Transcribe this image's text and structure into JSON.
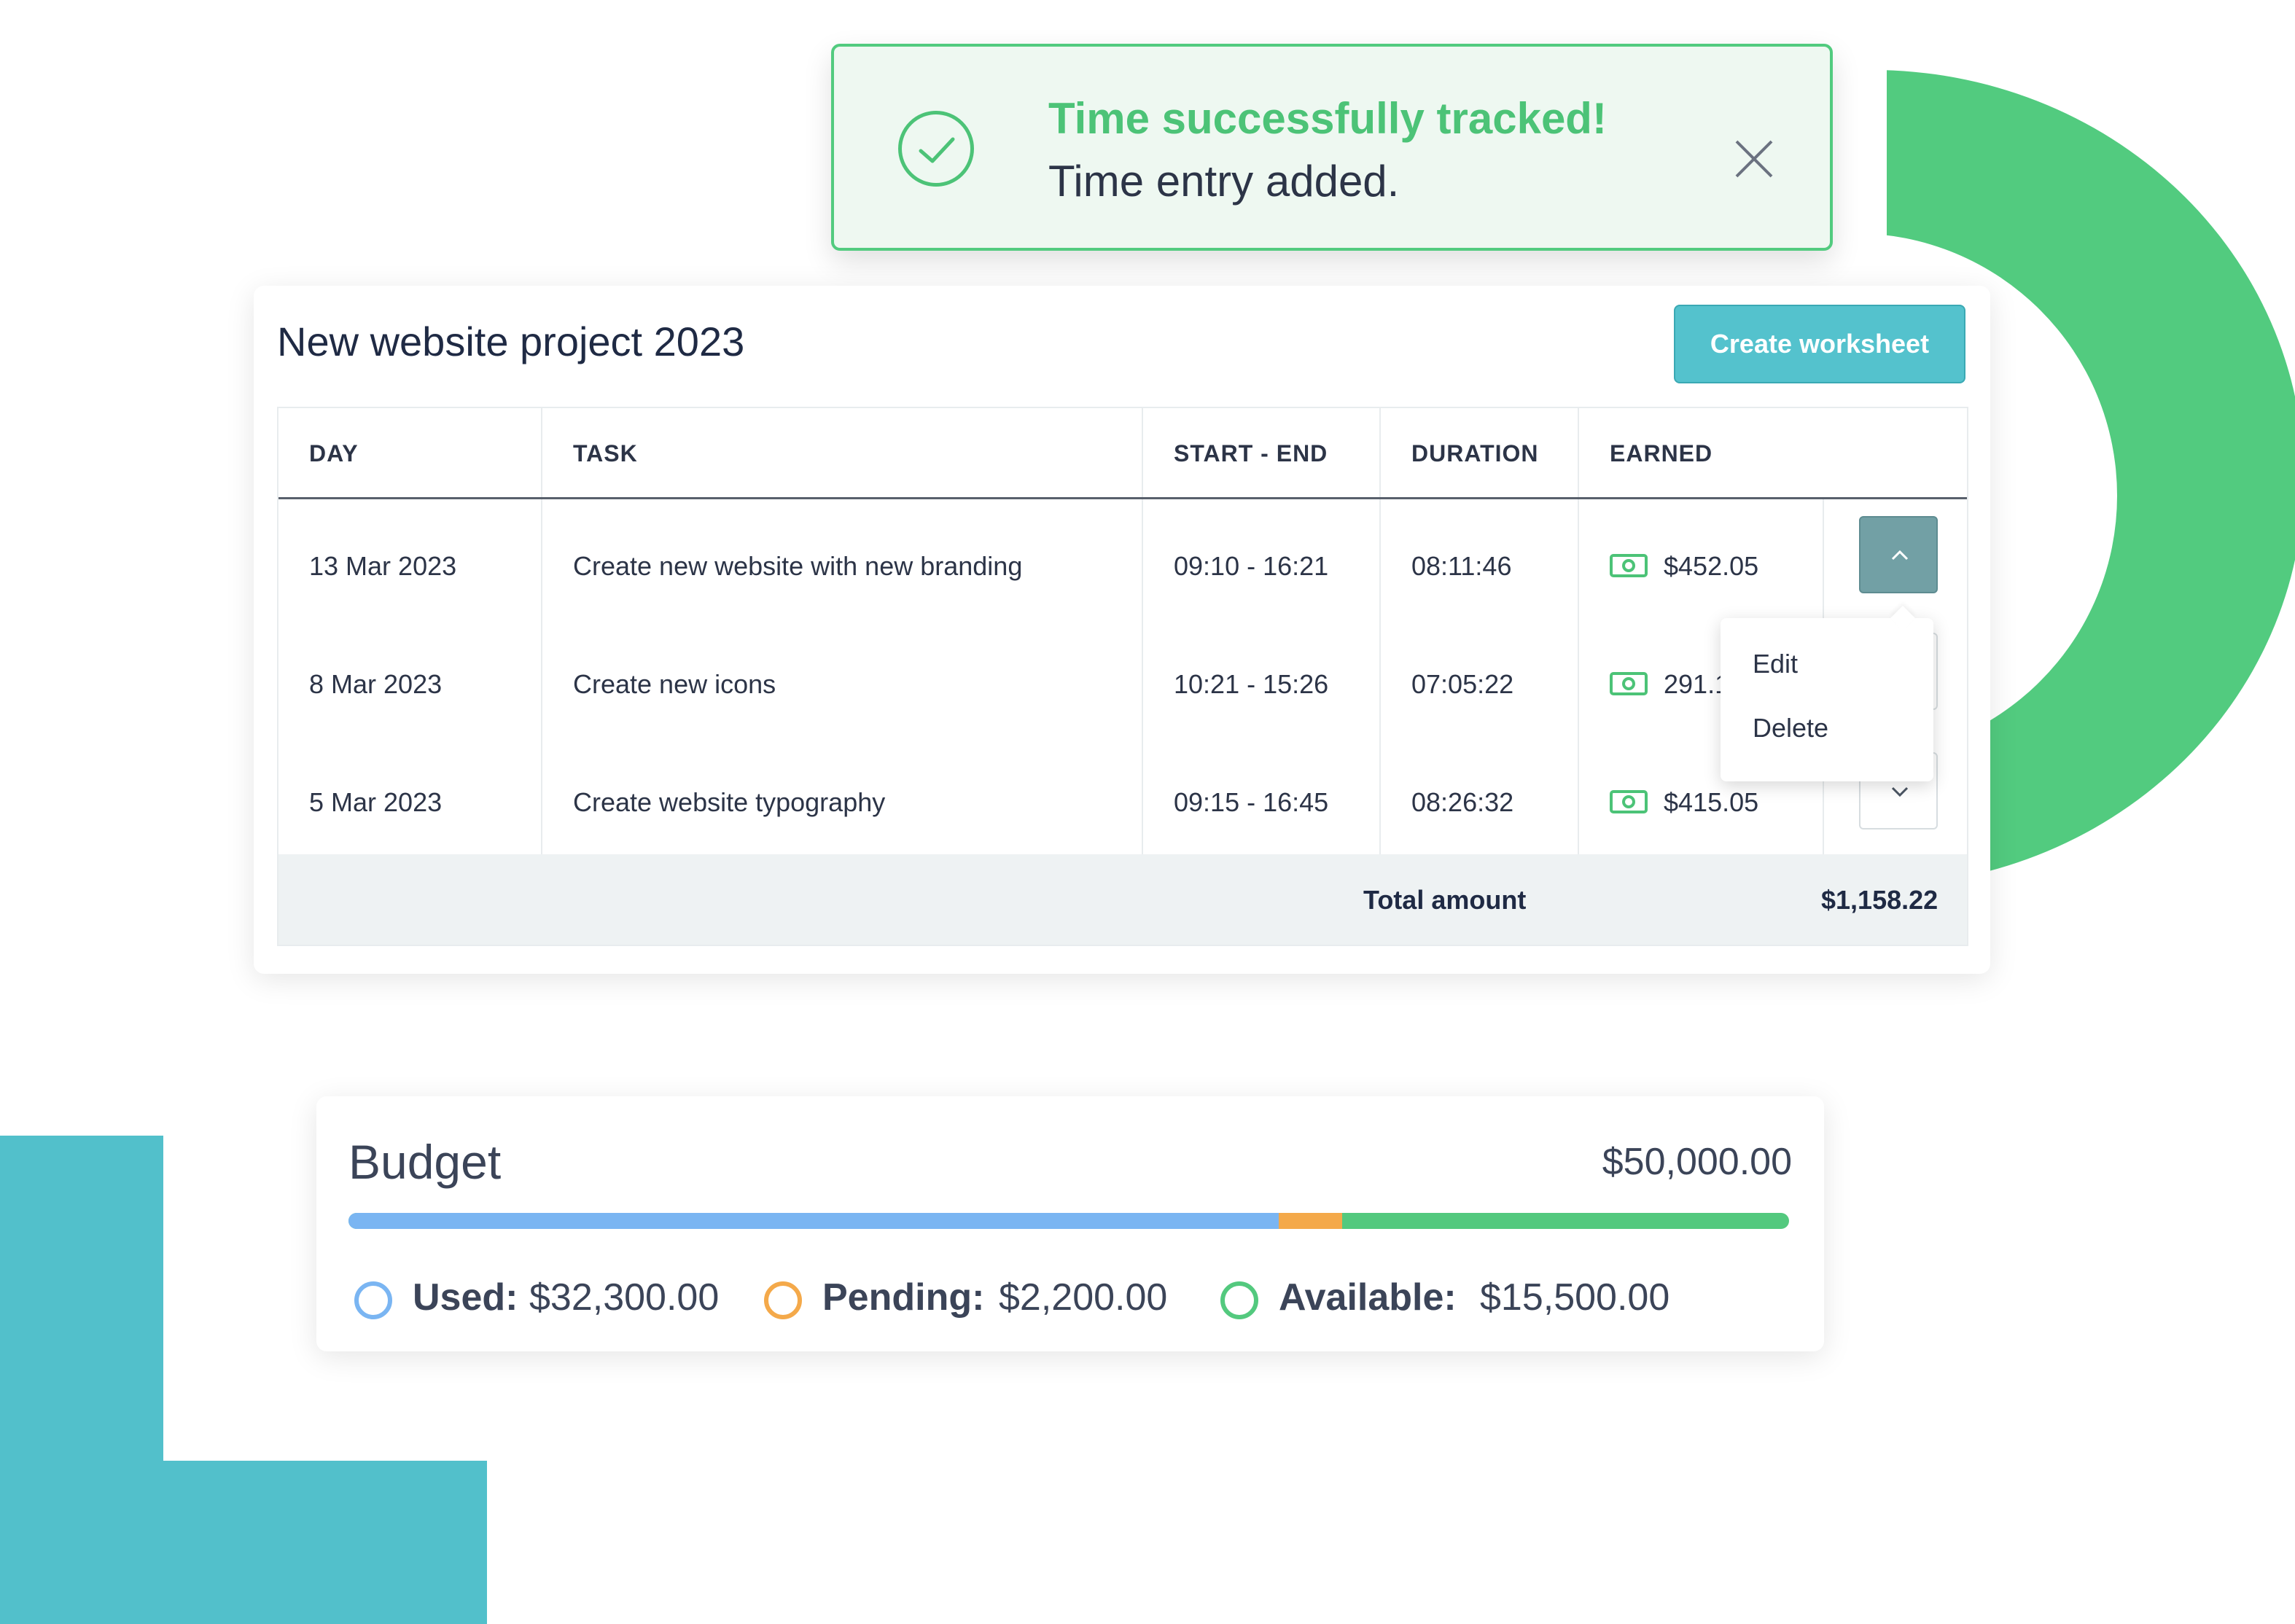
{
  "toast": {
    "title": "Time successfully tracked!",
    "message": "Time entry added.",
    "icon": "check-circle-icon",
    "close_icon": "close-icon",
    "accent_color": "#52cb7f"
  },
  "project": {
    "title": "New website project 2023",
    "create_button": "Create worksheet",
    "columns": [
      "DAY",
      "TASK",
      "START - END",
      "DURATION",
      "EARNED"
    ],
    "rows": [
      {
        "day": "13 Mar 2023",
        "task": "Create new website with new branding",
        "time": "09:10 - 16:21",
        "duration": "08:11:46",
        "earned": "$452.05"
      },
      {
        "day": "8 Mar 2023",
        "task": "Create new icons",
        "time": "10:21 - 15:26",
        "duration": "07:05:22",
        "earned": "291.1"
      },
      {
        "day": "5 Mar 2023",
        "task": "Create website typography",
        "time": "09:15 - 16:45",
        "duration": "08:26:32",
        "earned": "$415.05"
      }
    ],
    "total_label": "Total amount",
    "total_value": "$1,158.22",
    "row_menu": [
      "Edit",
      "Delete"
    ]
  },
  "budget": {
    "title": "Budget",
    "total": "$50,000.00",
    "used_label": "Used:",
    "used_value": "$32,300.00",
    "pending_label": "Pending:",
    "pending_value": "$2,200.00",
    "available_label": "Available:",
    "available_value": "$15,500.00",
    "used_fraction": 0.646,
    "pending_fraction": 0.044,
    "colors": {
      "used": "#7ab5f2",
      "pending": "#f4a94a",
      "available": "#53c97e"
    }
  }
}
